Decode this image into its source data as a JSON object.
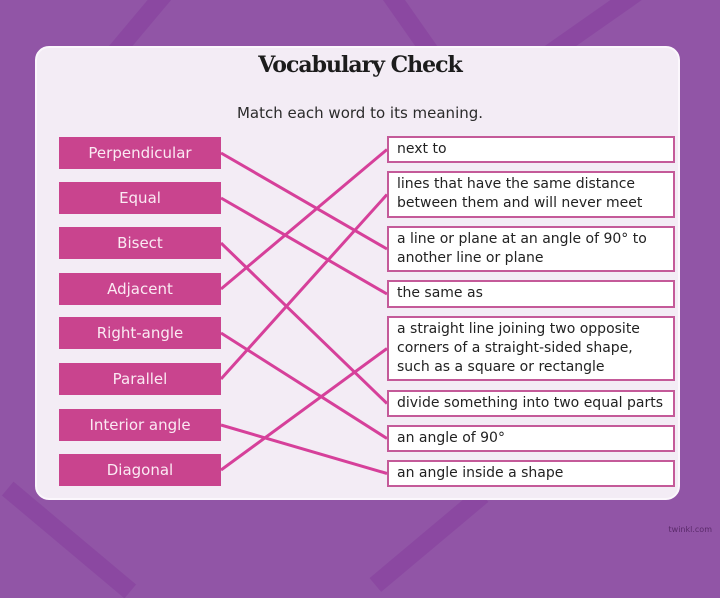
{
  "page": {
    "title": "Vocabulary Check",
    "subtitle": "Match each word to its meaning.",
    "credit": "twinkl.com"
  },
  "colors": {
    "background": "#9155a6",
    "card": "#f3ecf5",
    "word_box": "#c9448e",
    "line": "#d6409a",
    "definition_border": "#c45a99"
  },
  "words": [
    {
      "label": "Perpendicular"
    },
    {
      "label": "Equal"
    },
    {
      "label": "Bisect"
    },
    {
      "label": "Adjacent"
    },
    {
      "label": "Right-angle"
    },
    {
      "label": "Parallel"
    },
    {
      "label": "Interior angle"
    },
    {
      "label": "Diagonal"
    }
  ],
  "definitions": [
    {
      "text": "next to"
    },
    {
      "text": "lines that have the same distance between them and will never meet"
    },
    {
      "text": "a line or plane at an angle of 90° to another line or plane"
    },
    {
      "text": "the same as"
    },
    {
      "text": "a straight line joining two opposite corners of a straight-sided shape, such as a square or rectangle"
    },
    {
      "text": "divide something into two equal parts"
    },
    {
      "text": "an angle of 90°"
    },
    {
      "text": "an angle inside a shape"
    }
  ],
  "matches": [
    {
      "word": "Perpendicular",
      "definition_index": 2
    },
    {
      "word": "Equal",
      "definition_index": 3
    },
    {
      "word": "Bisect",
      "definition_index": 5
    },
    {
      "word": "Adjacent",
      "definition_index": 0
    },
    {
      "word": "Right-angle",
      "definition_index": 6
    },
    {
      "word": "Parallel",
      "definition_index": 1
    },
    {
      "word": "Interior angle",
      "definition_index": 7
    },
    {
      "word": "Diagonal",
      "definition_index": 4
    }
  ]
}
